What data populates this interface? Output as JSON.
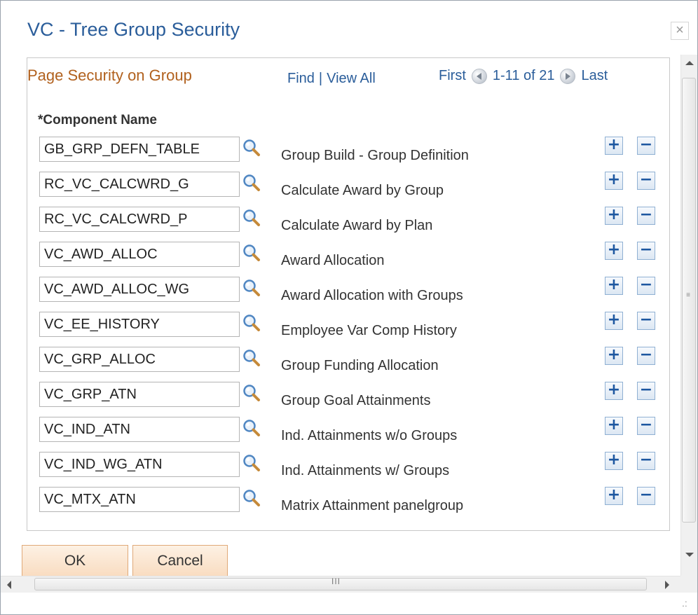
{
  "window": {
    "title": "VC - Tree Group Security",
    "close_symbol": "×"
  },
  "grid": {
    "title": "Page Security on Group",
    "find": "Find",
    "separator": "|",
    "view_all": "View All",
    "first": "First",
    "range": "1-11 of 21",
    "last": "Last",
    "column_header": "*Component Name",
    "rows": [
      {
        "code": "GB_GRP_DEFN_TABLE",
        "description": "Group Build - Group Definition"
      },
      {
        "code": "RC_VC_CALCWRD_G",
        "description": "Calculate Award by Group"
      },
      {
        "code": "RC_VC_CALCWRD_P",
        "description": "Calculate Award by Plan"
      },
      {
        "code": "VC_AWD_ALLOC",
        "description": "Award Allocation"
      },
      {
        "code": "VC_AWD_ALLOC_WG",
        "description": "Award Allocation with Groups"
      },
      {
        "code": "VC_EE_HISTORY",
        "description": "Employee Var Comp History"
      },
      {
        "code": "VC_GRP_ALLOC",
        "description": "Group Funding Allocation"
      },
      {
        "code": "VC_GRP_ATN",
        "description": "Group Goal Attainments"
      },
      {
        "code": "VC_IND_ATN",
        "description": "Ind. Attainments w/o Groups"
      },
      {
        "code": "VC_IND_WG_ATN",
        "description": "Ind. Attainments w/ Groups"
      },
      {
        "code": "VC_MTX_ATN",
        "description": "Matrix Attainment panelgroup"
      }
    ],
    "add_symbol": "+",
    "delete_symbol": "−"
  },
  "buttons": {
    "ok": "OK",
    "cancel": "Cancel"
  },
  "scrollbars": {
    "v_grip": "≡",
    "h_grip": "III",
    "resize_grip": ".:"
  },
  "icons": {
    "lookup": "magnifier-icon",
    "prev": "prev-arrow-icon",
    "next": "next-arrow-icon"
  },
  "colors": {
    "title": "#2a5d9a",
    "grid_title": "#b1611e",
    "link": "#2a5d9a",
    "button_border": "#e0a978"
  }
}
